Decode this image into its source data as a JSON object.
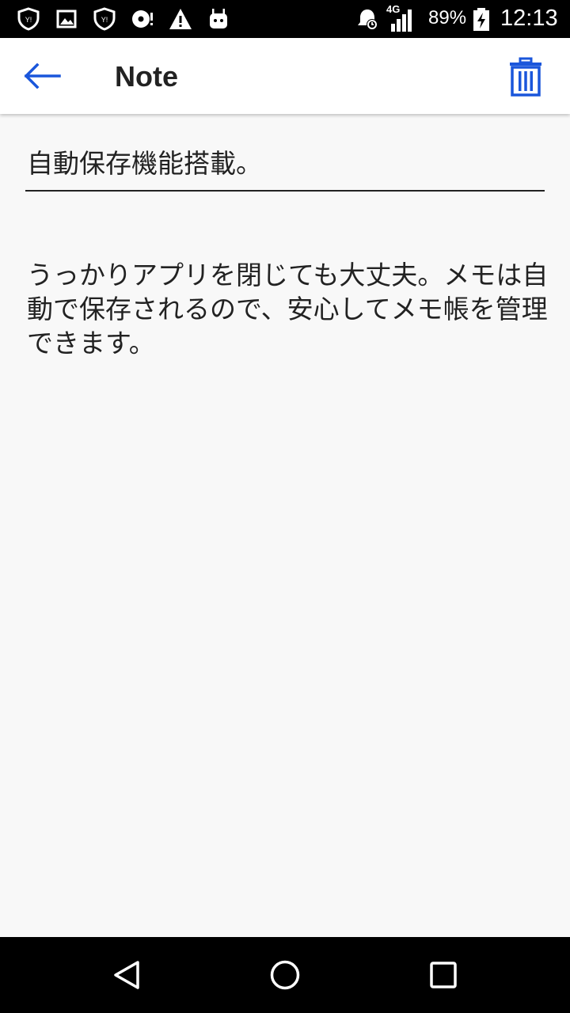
{
  "status_bar": {
    "network": "4G",
    "battery_percent": "89%",
    "time": "12:13"
  },
  "app_bar": {
    "title": "Note",
    "back_icon": "arrow-left-icon",
    "delete_icon": "trash-icon",
    "accent_color": "#1a56db"
  },
  "note": {
    "title": "自動保存機能搭載。",
    "body": "うっかりアプリを閉じても大丈夫。メモは自動で保存されるので、安心してメモ帳を管理できます。"
  },
  "nav_bar": {
    "back_icon": "triangle-back-icon",
    "home_icon": "circle-home-icon",
    "recents_icon": "square-recents-icon"
  }
}
